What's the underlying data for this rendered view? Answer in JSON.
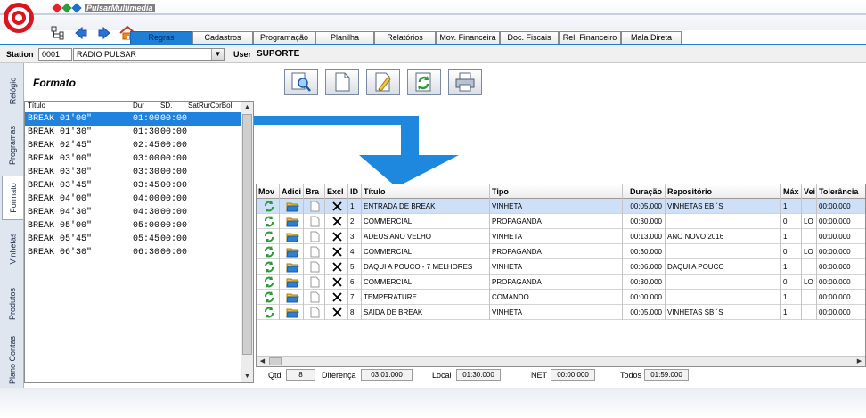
{
  "app": {
    "brand": "PulsarMultimedia",
    "brand_colors": [
      "#e8202a",
      "#2f9a3e",
      "#1e6fd0",
      "#f0a41c"
    ],
    "accent": "#1e7fd6"
  },
  "tabs": [
    {
      "label": "Regras",
      "active": true
    },
    {
      "label": "Cadastros"
    },
    {
      "label": "Programação"
    },
    {
      "label": "Planilha"
    },
    {
      "label": "Relatórios"
    },
    {
      "label": "Mov. Financeira"
    },
    {
      "label": "Doc. Fiscais"
    },
    {
      "label": "Rel. Financeiro"
    },
    {
      "label": "Mala Direta"
    }
  ],
  "station": {
    "label": "Station",
    "code": "0001",
    "name": "RADIO PULSAR",
    "user_label": "User",
    "user": "SUPORTE"
  },
  "side_tabs": [
    {
      "label": "Relógio"
    },
    {
      "label": "Programas"
    },
    {
      "label": "Formato",
      "active": true
    },
    {
      "label": "Vinhetas"
    },
    {
      "label": "Produtos"
    },
    {
      "label": "Plano Contas"
    }
  ],
  "section_title": "Formato",
  "left_list": {
    "headers": {
      "title": "Título",
      "dur": "Dur",
      "sd": "SD.",
      "days": "SatRurCorBol"
    },
    "rows": [
      {
        "title": "BREAK 01'00\"",
        "dur": "01:00",
        "sd": "00:00"
      },
      {
        "title": "BREAK 01'30\"",
        "dur": "01:30",
        "sd": "00:00"
      },
      {
        "title": "BREAK 02'45\"",
        "dur": "02:45",
        "sd": "00:00"
      },
      {
        "title": "BREAK 03'00\"",
        "dur": "03:00",
        "sd": "00:00"
      },
      {
        "title": "BREAK 03'30\"",
        "dur": "03:30",
        "sd": "00:00"
      },
      {
        "title": "BREAK 03'45\"",
        "dur": "03:45",
        "sd": "00:00"
      },
      {
        "title": "BREAK 04'00\"",
        "dur": "04:00",
        "sd": "00:00"
      },
      {
        "title": "BREAK 04'30\"",
        "dur": "04:30",
        "sd": "00:00"
      },
      {
        "title": "BREAK 05'00\"",
        "dur": "05:00",
        "sd": "00:00"
      },
      {
        "title": "BREAK 05'45\"",
        "dur": "05:45",
        "sd": "00:00"
      },
      {
        "title": "BREAK 06'30\"",
        "dur": "06:30",
        "sd": "00:00"
      }
    ]
  },
  "grid": {
    "headers": {
      "mov": "Mov",
      "adici": "Adici",
      "bra": "Bra",
      "excl": "Excl",
      "id": "ID",
      "titulo": "Título",
      "tipo": "Tipo",
      "duracao": "Duração",
      "repositorio": "Repositório",
      "max": "Máx",
      "vei": "Vei",
      "tolerancia": "Tolerância"
    },
    "rows": [
      {
        "id": "1",
        "titulo": "ENTRADA DE BREAK",
        "tipo": "VINHETA",
        "duracao": "00:05.000",
        "repositorio": "VINHETAS EB ´S",
        "max": "1",
        "vei": "",
        "tolerancia": "00:00.000"
      },
      {
        "id": "2",
        "titulo": "COMMERCIAL",
        "tipo": "PROPAGANDA",
        "duracao": "00:30.000",
        "repositorio": "",
        "max": "0",
        "vei": "LO",
        "tolerancia": "00:00.000"
      },
      {
        "id": "3",
        "titulo": "ADEUS ANO VELHO",
        "tipo": "VINHETA",
        "duracao": "00:13.000",
        "repositorio": "ANO NOVO 2016",
        "max": "1",
        "vei": "",
        "tolerancia": "00:00.000"
      },
      {
        "id": "4",
        "titulo": "COMMERCIAL",
        "tipo": "PROPAGANDA",
        "duracao": "00:30.000",
        "repositorio": "",
        "max": "0",
        "vei": "LO",
        "tolerancia": "00:00.000"
      },
      {
        "id": "5",
        "titulo": "DAQUI A POUCO -  7 MELHORES",
        "tipo": "VINHETA",
        "duracao": "00:06.000",
        "repositorio": "DAQUI A POUCO",
        "max": "1",
        "vei": "",
        "tolerancia": "00:00.000"
      },
      {
        "id": "6",
        "titulo": "COMMERCIAL",
        "tipo": "PROPAGANDA",
        "duracao": "00:30.000",
        "repositorio": "",
        "max": "0",
        "vei": "LO",
        "tolerancia": "00:00.000"
      },
      {
        "id": "7",
        "titulo": "TEMPERATURE",
        "tipo": "COMANDO",
        "duracao": "00:00.000",
        "repositorio": "",
        "max": "1",
        "vei": "",
        "tolerancia": "00:00.000"
      },
      {
        "id": "8",
        "titulo": "SAIDA DE BREAK",
        "tipo": "VINHETA",
        "duracao": "00:05.000",
        "repositorio": "VINHETAS SB ´S",
        "max": "1",
        "vei": "",
        "tolerancia": "00:00.000"
      }
    ]
  },
  "footer": {
    "qtd_label": "Qtd",
    "qtd": "8",
    "diferenca_label": "Diferença",
    "diferenca": "03:01.000",
    "local_label": "Local",
    "local": "01:30.000",
    "net_label": "NET",
    "net": "00:00.000",
    "todos_label": "Todos",
    "todos": "01:59.000"
  }
}
